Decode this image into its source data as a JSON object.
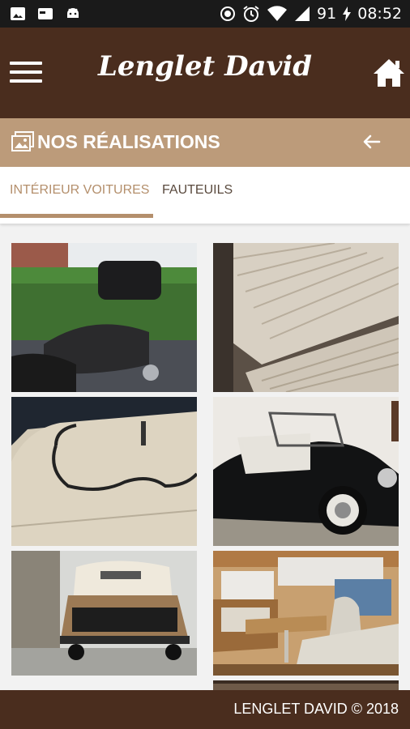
{
  "status_bar": {
    "battery": "91",
    "time": "08:52"
  },
  "app": {
    "title": "Lenglet David"
  },
  "section": {
    "title": "NOS RÉALISATIONS"
  },
  "tabs": [
    {
      "label": "INTÉRIEUR VOITURES",
      "active": true
    },
    {
      "label": "FAUTEUILS",
      "active": false
    }
  ],
  "gallery": [
    {
      "subject": "motorcycle seat with backrest"
    },
    {
      "subject": "cream pleated car bench seat"
    },
    {
      "subject": "cream car door panel with piping"
    },
    {
      "subject": "black vintage convertible car"
    },
    {
      "subject": "rear of vintage car with tan top"
    },
    {
      "subject": "camper van interior with seats"
    }
  ],
  "footer": {
    "text": "LENGLET DAVID © 2018"
  },
  "colors": {
    "primary": "#4a2d1e",
    "accent": "#bc9b7a",
    "tab_active": "#b48f6c"
  }
}
